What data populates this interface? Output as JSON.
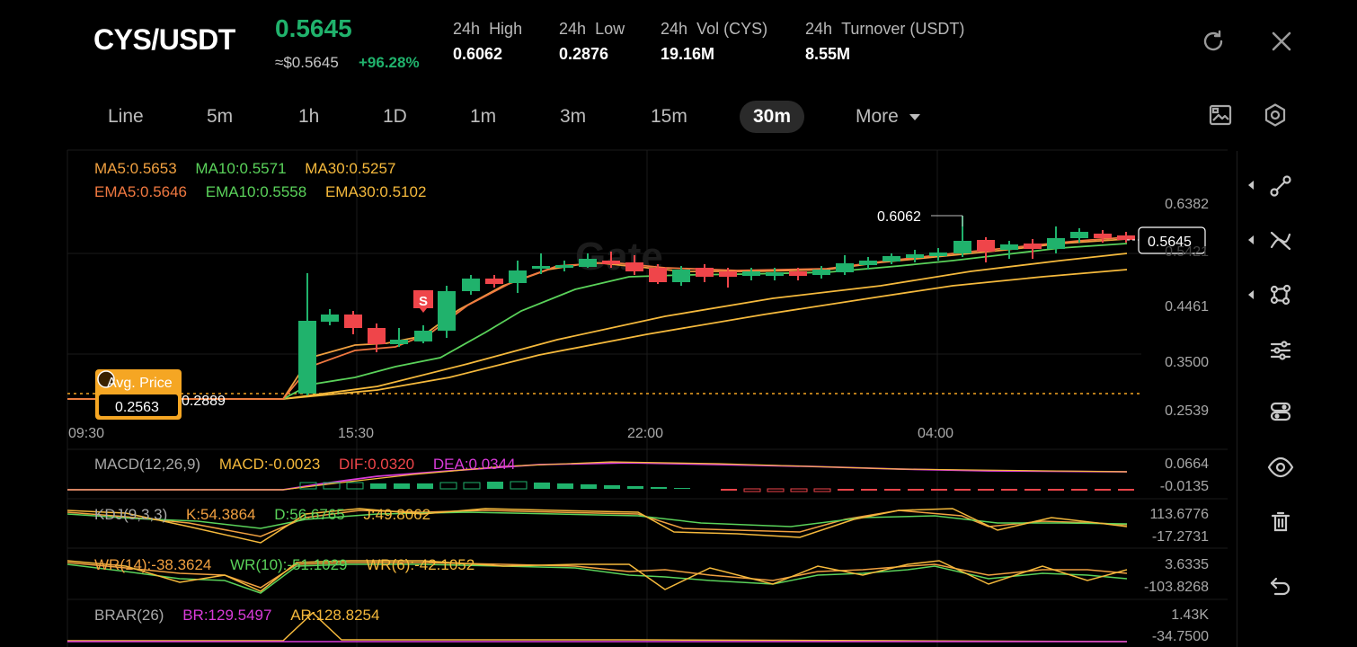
{
  "header": {
    "pair": "CYS/USDT",
    "price": "0.5645",
    "usd_price": "≈$0.5645",
    "change": "+96.28%",
    "stats": [
      {
        "label_a": "24h",
        "label_b": "High",
        "value": "0.6062"
      },
      {
        "label_a": "24h",
        "label_b": "Low",
        "value": "0.2876"
      },
      {
        "label_a": "24h",
        "label_b": "Vol (CYS)",
        "value": "19.16M"
      },
      {
        "label_a": "24h",
        "label_b": "Turnover (USDT)",
        "value": "8.55M"
      }
    ],
    "refresh_icon": "refresh-icon",
    "close_icon": "close-icon"
  },
  "timeframes": {
    "items": [
      "Line",
      "5m",
      "1h",
      "1D",
      "1m",
      "3m",
      "15m",
      "30m"
    ],
    "active": "30m",
    "more_label": "More"
  },
  "toolbar_icons": [
    "image-icon",
    "settings-icon"
  ],
  "main_chart": {
    "ma_legend": {
      "ma5": "MA5:0.5653",
      "ma10": "MA10:0.5571",
      "ma30": "MA30:0.5257"
    },
    "ema_legend": {
      "ema5": "EMA5:0.5646",
      "ema10": "EMA10:0.5558",
      "ema30": "EMA30:0.5102"
    },
    "y_ticks": [
      "0.6382",
      "0.5421",
      "0.4461",
      "0.3500",
      "0.2539"
    ],
    "x_ticks": [
      "09:30",
      "15:30",
      "22:00",
      "04:00"
    ],
    "high_marker": "0.6062",
    "last_price_tag": "0.5645",
    "avg_price_label": "Avg. Price",
    "avg_price_value": "0.2563",
    "avg_line_value": "0.2889",
    "sell_marker": "S",
    "watermark": "Gate",
    "colors": {
      "up": "#20b26c",
      "down": "#ef454a",
      "ma5": "#f0a040",
      "ma10": "#5ad25a",
      "ma30": "#f5b93c",
      "avg": "#f5a623"
    }
  },
  "indicators": {
    "macd": {
      "name": "MACD(12,26,9)",
      "macd": "MACD:-0.0023",
      "dif": "DIF:0.0320",
      "dea": "DEA:0.0344",
      "y_top": "0.0664",
      "y_bottom": "-0.0135"
    },
    "kdj": {
      "name": "KDJ(9,3,3)",
      "k": "K:54.3864",
      "d": "D:56.6765",
      "j": "J:49.8062",
      "y_top": "113.6776",
      "y_bottom": "-17.2731"
    },
    "wr": {
      "name": "WR(14):-38.3624",
      "wr10": "WR(10):-51.1029",
      "wr6": "WR(6):-42.1052",
      "y_top": "3.6335",
      "y_bottom": "-103.8268"
    },
    "brar": {
      "name": "BRAR(26)",
      "br": "BR:129.5497",
      "ar": "AR:128.8254",
      "y_top": "1.43K",
      "y_bottom": "-34.7500"
    }
  },
  "sidebar_tools": [
    "trend-line-icon",
    "cross-line-icon",
    "shape-icon",
    "indicator-settings-icon",
    "layers-icon",
    "visibility-icon",
    "delete-icon",
    "undo-icon"
  ]
}
